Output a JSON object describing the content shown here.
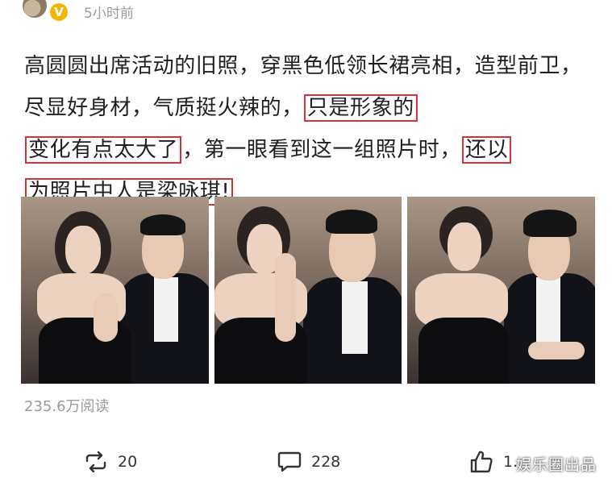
{
  "header": {
    "verified_badge": "V",
    "time_ago": "5小时前"
  },
  "post": {
    "segments": [
      {
        "text": "高圆圆出席活动的旧照，穿黑色低领长裙亮相，造型前卫，尽显好身材，气质挺火辣的，",
        "highlight": false
      },
      {
        "text": "只是形象的",
        "highlight": true
      },
      {
        "text": "变化有点太大了",
        "highlight": true
      },
      {
        "text": "，第一眼看到这一组照片时，",
        "highlight": false
      },
      {
        "text": "还以",
        "highlight": true
      },
      {
        "text": "为照片中人是梁咏琪!",
        "highlight": true
      }
    ],
    "highlight_color": "#d9303f"
  },
  "photos": [
    {
      "icon": "photo-couple-1"
    },
    {
      "icon": "photo-couple-2"
    },
    {
      "icon": "photo-couple-3"
    }
  ],
  "stats": {
    "read_count": "235.6万阅读"
  },
  "actions": {
    "repost_count": "20",
    "comment_count": "228",
    "like_count": "1.",
    "repost_icon": "repost-icon",
    "comment_icon": "comment-icon",
    "like_icon": "thumbs-up-icon"
  },
  "watermark": "娱乐圈出品"
}
